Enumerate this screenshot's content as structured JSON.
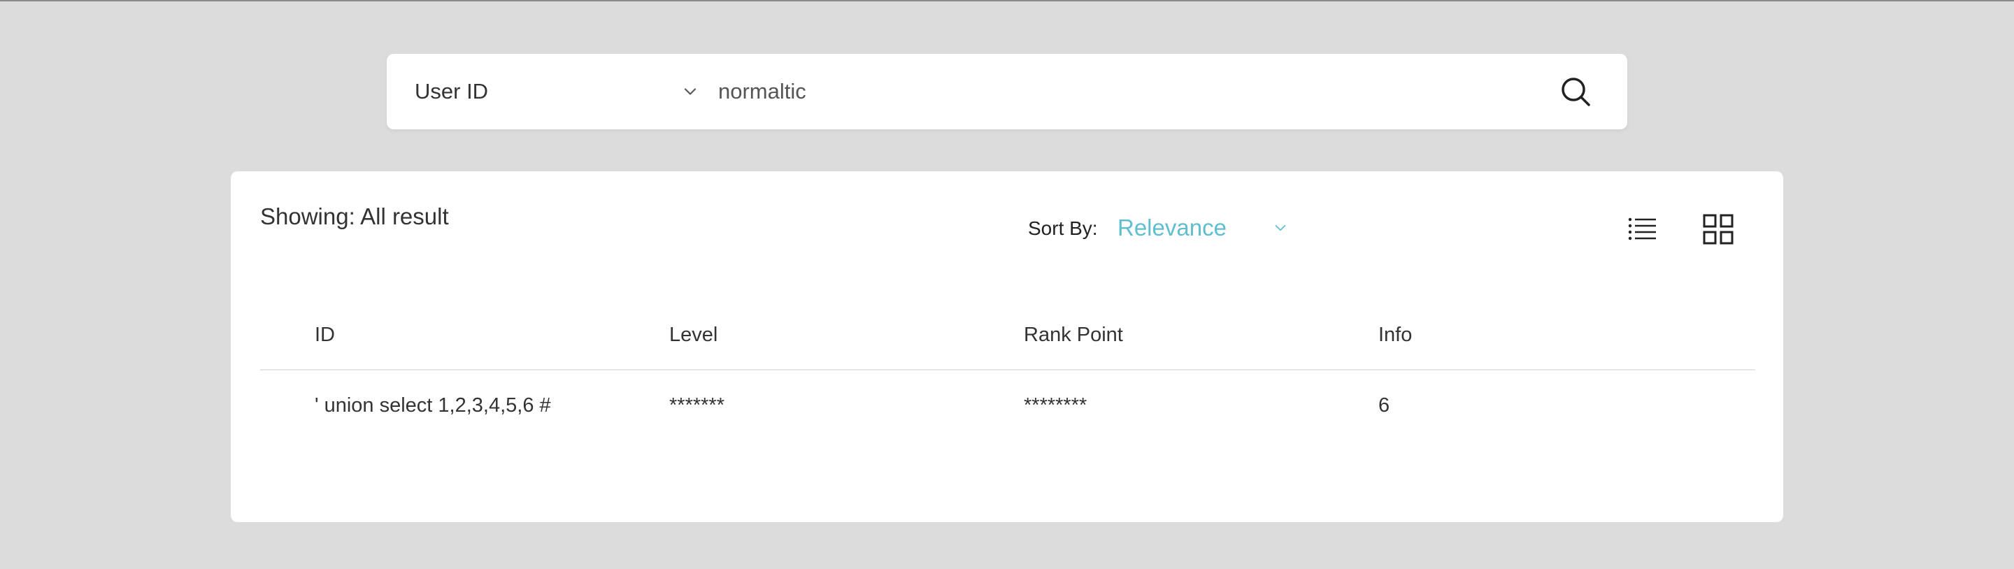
{
  "search": {
    "field_selected": "User ID",
    "query_value": "normaltic",
    "search_icon": "search-icon",
    "chevron_icon": "chevron-down-icon"
  },
  "results": {
    "showing_label": "Showing: All result",
    "sort_label": "Sort By:",
    "sort_value": "Relevance",
    "accent_color": "#5fbfcf",
    "view_icons": [
      "list-view-icon",
      "grid-view-icon"
    ],
    "columns": [
      "ID",
      "Level",
      "Rank Point",
      "Info"
    ],
    "rows": [
      {
        "id": "' union select 1,2,3,4,5,6 #",
        "level": "*******",
        "rank_point": "********",
        "info": "6"
      }
    ]
  }
}
